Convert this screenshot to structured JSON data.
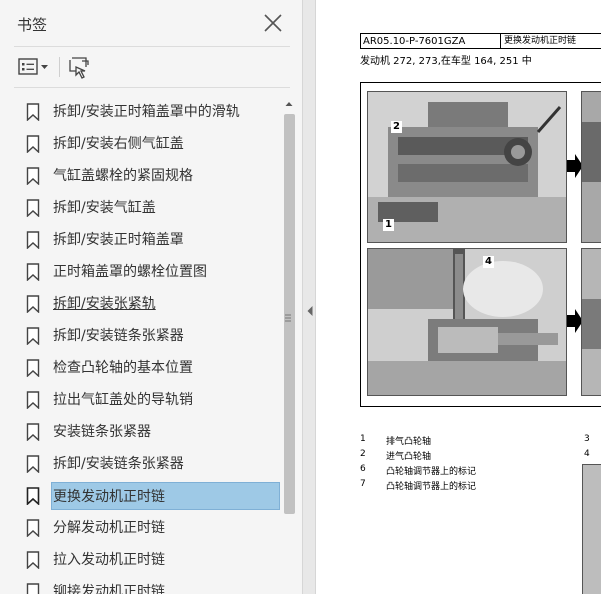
{
  "panel": {
    "title": "书签",
    "close_icon": "close-icon",
    "options_icon": "bookmark-options-icon",
    "expand_icon": "expand-current-bookmark-icon"
  },
  "bookmarks": [
    {
      "label": "拆卸/安装正时箱盖罩中的滑轨",
      "selected": false,
      "underlined": false
    },
    {
      "label": "拆卸/安装右侧气缸盖",
      "selected": false,
      "underlined": false
    },
    {
      "label": "气缸盖螺栓的紧固规格",
      "selected": false,
      "underlined": false
    },
    {
      "label": "拆卸/安装气缸盖",
      "selected": false,
      "underlined": false
    },
    {
      "label": "拆卸/安装正时箱盖罩",
      "selected": false,
      "underlined": false
    },
    {
      "label": "正时箱盖罩的螺栓位置图",
      "selected": false,
      "underlined": false
    },
    {
      "label": "拆卸/安装张紧轨",
      "selected": false,
      "underlined": true
    },
    {
      "label": "拆卸/安装链条张紧器",
      "selected": false,
      "underlined": false
    },
    {
      "label": "检查凸轮轴的基本位置",
      "selected": false,
      "underlined": false
    },
    {
      "label": "拉出气缸盖处的导轨销",
      "selected": false,
      "underlined": false
    },
    {
      "label": "安装链条张紧器",
      "selected": false,
      "underlined": false
    },
    {
      "label": "拆卸/安装链条张紧器",
      "selected": false,
      "underlined": false
    },
    {
      "label": "更换发动机正时链",
      "selected": true,
      "underlined": false
    },
    {
      "label": "分解发动机正时链",
      "selected": false,
      "underlined": false
    },
    {
      "label": "拉入发动机正时链",
      "selected": false,
      "underlined": false
    },
    {
      "label": "铆接发动机正时链",
      "selected": false,
      "underlined": false
    }
  ],
  "document": {
    "code": "AR05.10-P-7601GZA",
    "title": "更换发动机正时链",
    "subtitle": "发动机 272, 273,在车型 164, 251 中",
    "callouts": {
      "c1": "1",
      "c2": "2",
      "c4": "4"
    },
    "legend": [
      {
        "num": "1",
        "text": "排气凸轮轴",
        "num2": "3"
      },
      {
        "num": "2",
        "text": "进气凸轮轴",
        "num2": "4"
      },
      {
        "num": "6",
        "text": "凸轮轴调节器上的标记",
        "num2": ""
      },
      {
        "num": "7",
        "text": "凸轮轴调节器上的标记",
        "num2": ""
      }
    ]
  },
  "colors": {
    "panel_bg": "#f5f5f5",
    "selected_bg": "#9ec9e6",
    "text": "#333333"
  }
}
